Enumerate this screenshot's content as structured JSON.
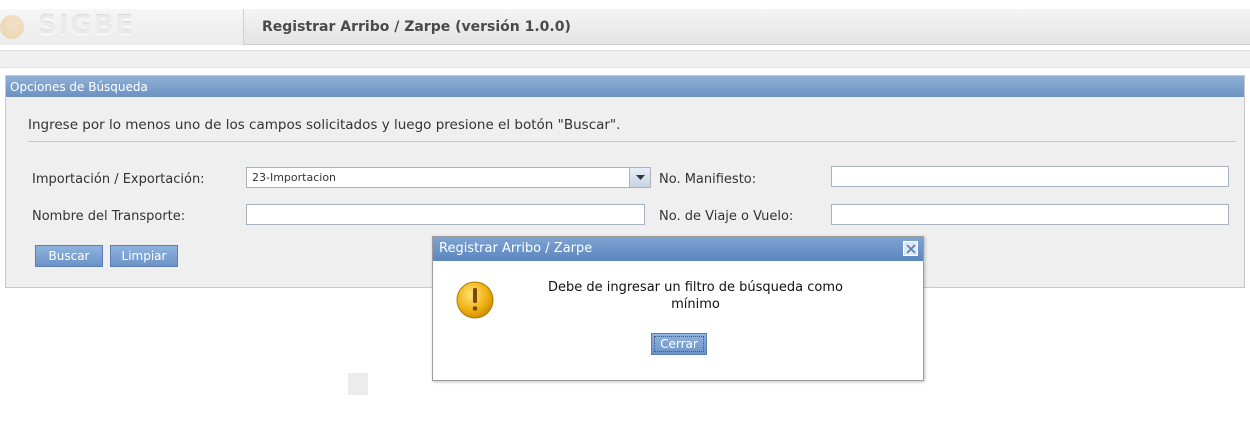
{
  "header": {
    "logo_text": "SIGBE",
    "title": "Registrar Arribo / Zarpe (versión 1.0.0)"
  },
  "panel": {
    "title": "Opciones de Búsqueda",
    "instructions": "Ingrese por lo menos uno de los campos solicitados y luego presione el botón \"Buscar\".",
    "fields": {
      "import_export_label": "Importación / Exportación:",
      "import_export_value": "23-Importacion",
      "manifest_label": "No. Manifiesto:",
      "manifest_value": "",
      "transport_label": "Nombre del Transporte:",
      "transport_value": "",
      "trip_label": "No. de Viaje o Vuelo:",
      "trip_value": ""
    },
    "buttons": {
      "search": "Buscar",
      "clear": "Limpiar"
    }
  },
  "dialog": {
    "title": "Registrar Arribo / Zarpe",
    "message": "Debe de ingresar un filtro de búsqueda como mínimo",
    "close_button": "Cerrar",
    "icon": "warning-icon"
  },
  "colors": {
    "panel_header": "#7a9dcb",
    "button": "#7ca2d3",
    "warning": "#f0b020"
  }
}
